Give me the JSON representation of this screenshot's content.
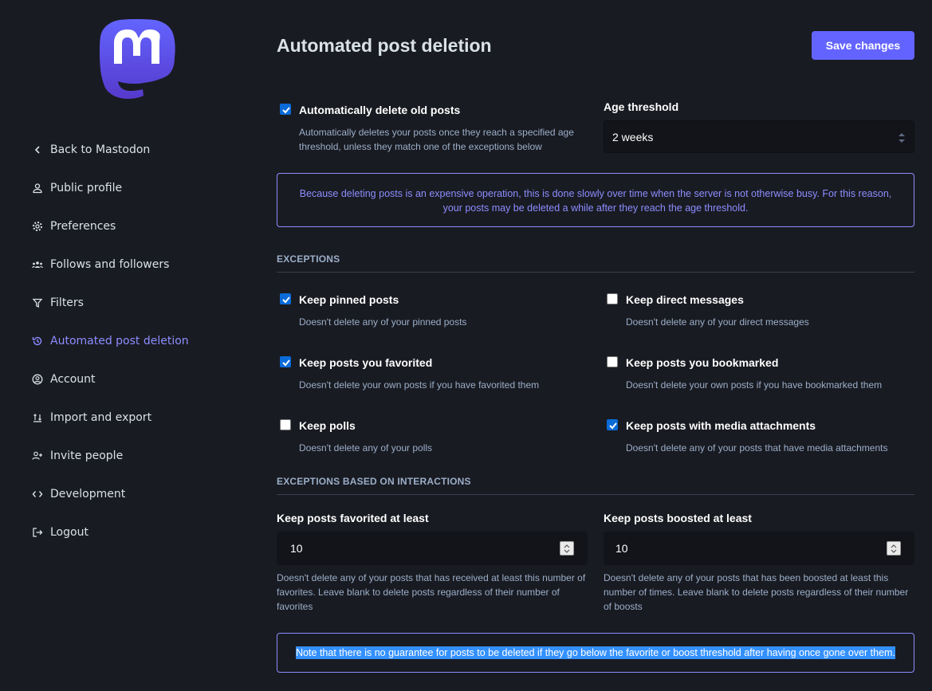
{
  "sidebar": {
    "items": [
      {
        "label": "Back to Mastodon",
        "icon": "chevron-left-icon",
        "active": false
      },
      {
        "label": "Public profile",
        "icon": "person-icon",
        "active": false
      },
      {
        "label": "Preferences",
        "icon": "gear-icon",
        "active": false
      },
      {
        "label": "Follows and followers",
        "icon": "people-icon",
        "active": false
      },
      {
        "label": "Filters",
        "icon": "filter-icon",
        "active": false
      },
      {
        "label": "Automated post deletion",
        "icon": "history-icon",
        "active": true
      },
      {
        "label": "Account",
        "icon": "user-circle-icon",
        "active": false
      },
      {
        "label": "Import and export",
        "icon": "import-export-icon",
        "active": false
      },
      {
        "label": "Invite people",
        "icon": "user-plus-icon",
        "active": false
      },
      {
        "label": "Development",
        "icon": "code-icon",
        "active": false
      },
      {
        "label": "Logout",
        "icon": "logout-icon",
        "active": false
      }
    ]
  },
  "header": {
    "title": "Automated post deletion",
    "save_label": "Save changes"
  },
  "auto_delete": {
    "label": "Automatically delete old posts",
    "hint": "Automatically deletes your posts once they reach a specified age threshold, unless they match one of the exceptions below",
    "checked": true
  },
  "age_threshold": {
    "label": "Age threshold",
    "value": "2 weeks"
  },
  "notice": "Because deleting posts is an expensive operation, this is done slowly over time when the server is not otherwise busy. For this reason, your posts may be deleted a while after they reach the age threshold.",
  "exceptions": {
    "heading": "EXCEPTIONS",
    "items": [
      {
        "label": "Keep pinned posts",
        "hint": "Doesn't delete any of your pinned posts",
        "checked": true
      },
      {
        "label": "Keep direct messages",
        "hint": "Doesn't delete any of your direct messages",
        "checked": false
      },
      {
        "label": "Keep posts you favorited",
        "hint": "Doesn't delete your own posts if you have favorited them",
        "checked": true
      },
      {
        "label": "Keep posts you bookmarked",
        "hint": "Doesn't delete your own posts if you have bookmarked them",
        "checked": false
      },
      {
        "label": "Keep polls",
        "hint": "Doesn't delete any of your polls",
        "checked": false
      },
      {
        "label": "Keep posts with media attachments",
        "hint": "Doesn't delete any of your posts that have media attachments",
        "checked": true
      }
    ]
  },
  "interactions": {
    "heading": "EXCEPTIONS BASED ON INTERACTIONS",
    "favorites": {
      "label": "Keep posts favorited at least",
      "value": "10",
      "hint": "Doesn't delete any of your posts that has received at least this number of favorites. Leave blank to delete posts regardless of their number of favorites"
    },
    "boosts": {
      "label": "Keep posts boosted at least",
      "value": "10",
      "hint": "Doesn't delete any of your posts that has been boosted at least this number of times. Leave blank to delete posts regardless of their number of boosts"
    }
  },
  "final_note": "Note that there is no guarantee for posts to be deleted if they go below the favorite or boost threshold after having once gone over them.",
  "colors": {
    "background": "#191b22",
    "accent": "#6364ff",
    "accent_text": "#8c8dff",
    "checkbox": "#0a6bd9"
  }
}
